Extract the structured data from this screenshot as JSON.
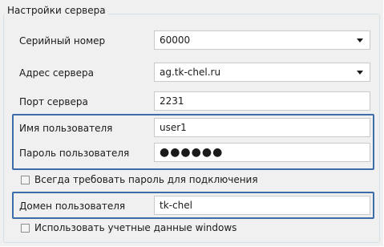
{
  "group": {
    "title": "Настройки сервера"
  },
  "fields": {
    "serial": {
      "label": "Серийный номер",
      "value": "60000"
    },
    "address": {
      "label": "Адрес сервера",
      "value": "ag.tk-chel.ru"
    },
    "port": {
      "label": "Порт сервера",
      "value": "2231"
    },
    "username": {
      "label": "Имя пользователя",
      "value": "user1"
    },
    "password": {
      "label": "Пароль пользователя",
      "value": "●●●●●●"
    },
    "domain": {
      "label": "Домен пользователя",
      "value": "tk-chel"
    }
  },
  "checkboxes": {
    "always_password": {
      "label": "Всегда требовать пароль для подключения",
      "checked": false
    },
    "use_windows": {
      "label": "Использовать учетные данные windows",
      "checked": false
    }
  },
  "icons": {
    "dropdown": "chevron-down-icon"
  },
  "colors": {
    "highlight": "#3d6da8"
  }
}
